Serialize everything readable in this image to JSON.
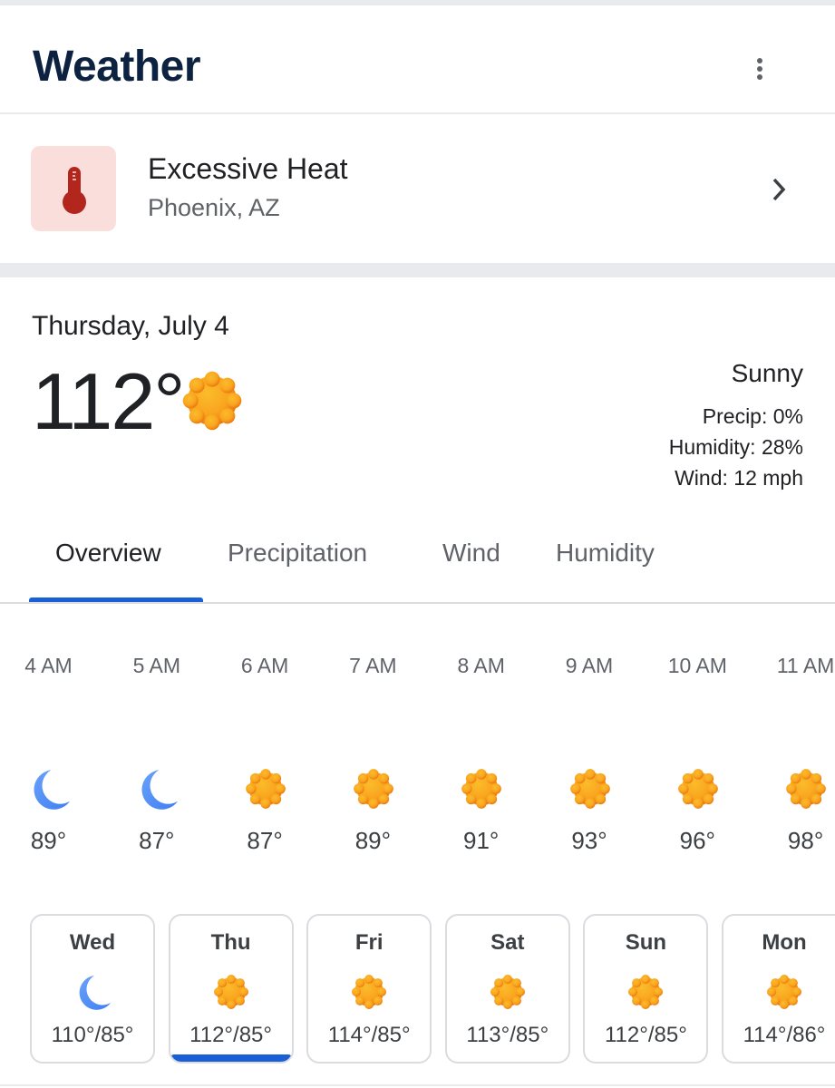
{
  "header": {
    "title": "Weather",
    "menu_icon": "more-vert-icon"
  },
  "alert": {
    "icon": "thermometer-icon",
    "title": "Excessive Heat",
    "location": "Phoenix, AZ",
    "chevron": "chevron-right-icon"
  },
  "current": {
    "date": "Thursday, July 4",
    "temperature": "112°",
    "icon": "sun-icon",
    "condition": "Sunny",
    "precip": "Precip: 0%",
    "humidity": "Humidity: 28%",
    "wind": "Wind: 12 mph"
  },
  "tabs": [
    {
      "label": "Overview",
      "active": true
    },
    {
      "label": "Precipitation"
    },
    {
      "label": "Wind"
    },
    {
      "label": "Humidity"
    }
  ],
  "hourly": [
    {
      "time": "4 AM",
      "icon": "moon",
      "temp": "89°"
    },
    {
      "time": "5 AM",
      "icon": "moon",
      "temp": "87°"
    },
    {
      "time": "6 AM",
      "icon": "sun",
      "temp": "87°"
    },
    {
      "time": "7 AM",
      "icon": "sun",
      "temp": "89°"
    },
    {
      "time": "8 AM",
      "icon": "sun",
      "temp": "91°"
    },
    {
      "time": "9 AM",
      "icon": "sun",
      "temp": "93°"
    },
    {
      "time": "10 AM",
      "icon": "sun",
      "temp": "96°"
    },
    {
      "time": "11 AM",
      "icon": "sun",
      "temp": "98°"
    }
  ],
  "daily": [
    {
      "day": "Wed",
      "icon": "moon",
      "range": "110°/85°"
    },
    {
      "day": "Thu",
      "icon": "sun",
      "range": "112°/85°",
      "selected": true
    },
    {
      "day": "Fri",
      "icon": "sun",
      "range": "114°/85°"
    },
    {
      "day": "Sat",
      "icon": "sun",
      "range": "113°/85°"
    },
    {
      "day": "Sun",
      "icon": "sun",
      "range": "112°/85°"
    },
    {
      "day": "Mon",
      "icon": "sun",
      "range": "114°/86°"
    }
  ],
  "colors": {
    "accent": "#1a5fd6",
    "alert_bg": "#fadedc",
    "alert_icon": "#b3261e",
    "sun": "#f9a825",
    "moon": "#4f8ef7"
  }
}
